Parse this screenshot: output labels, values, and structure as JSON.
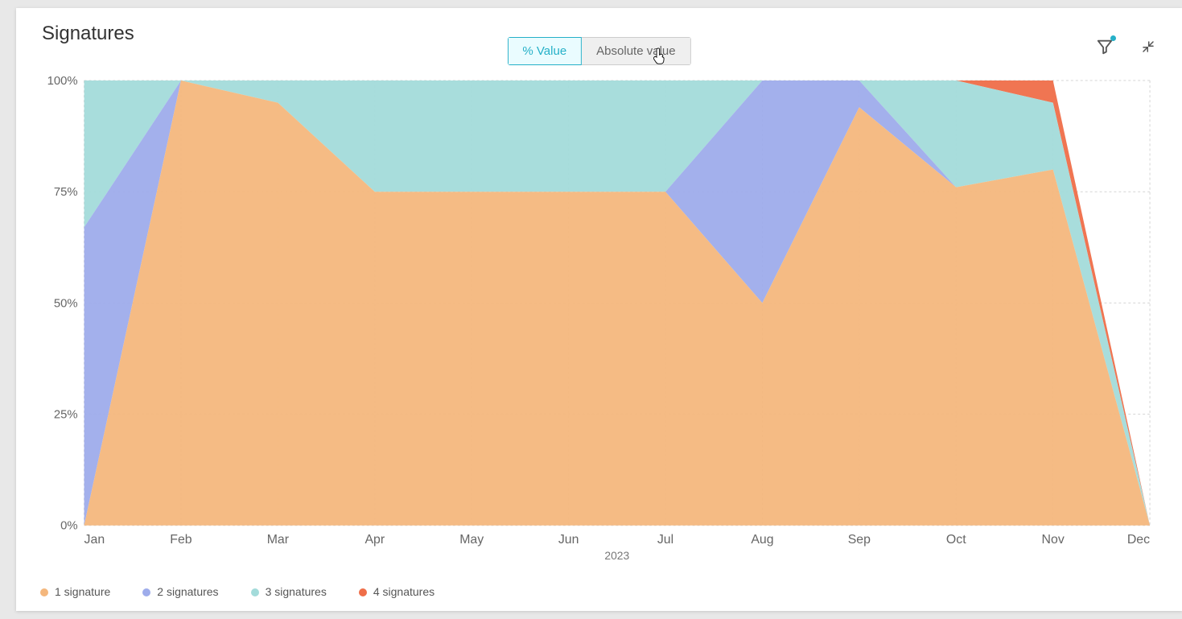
{
  "title": "Signatures",
  "modes": {
    "percent": "% Value",
    "absolute": "Absolute value",
    "active": "percent"
  },
  "chart_data": {
    "type": "area",
    "stacked": true,
    "units": "percent",
    "ylim": [
      0,
      100
    ],
    "yticks": [
      "0%",
      "25%",
      "50%",
      "75%",
      "100%"
    ],
    "categories": [
      "Jan",
      "Feb",
      "Mar",
      "Apr",
      "May",
      "Jun",
      "Jul",
      "Aug",
      "Sep",
      "Oct",
      "Nov",
      "Dec"
    ],
    "series": [
      {
        "name": "1 signature",
        "color": "#f4b77d",
        "values": [
          0,
          100,
          95,
          75,
          75,
          75,
          75,
          50,
          94,
          76,
          80,
          0
        ]
      },
      {
        "name": "2 signatures",
        "color": "#9eaceb",
        "values": [
          67,
          0,
          0,
          0,
          0,
          0,
          0,
          50,
          6,
          0,
          0,
          0
        ]
      },
      {
        "name": "3 signatures",
        "color": "#a3dbda",
        "values": [
          33,
          0,
          5,
          25,
          25,
          25,
          25,
          0,
          0,
          24,
          15,
          0
        ]
      },
      {
        "name": "4 signatures",
        "color": "#ef6e49",
        "values": [
          0,
          0,
          0,
          0,
          0,
          0,
          0,
          0,
          0,
          0,
          5,
          0
        ]
      }
    ],
    "xlabel": "2023",
    "ylabel": "",
    "legend_position": "bottom",
    "grid": true
  },
  "legend": [
    {
      "label": "1 signature",
      "color": "#f4b77d"
    },
    {
      "label": "2 signatures",
      "color": "#9eaceb"
    },
    {
      "label": "3 signatures",
      "color": "#a3dbda"
    },
    {
      "label": "4 signatures",
      "color": "#ef6e49"
    }
  ],
  "icons": {
    "filter": "filter-icon",
    "collapse": "collapse-icon"
  }
}
